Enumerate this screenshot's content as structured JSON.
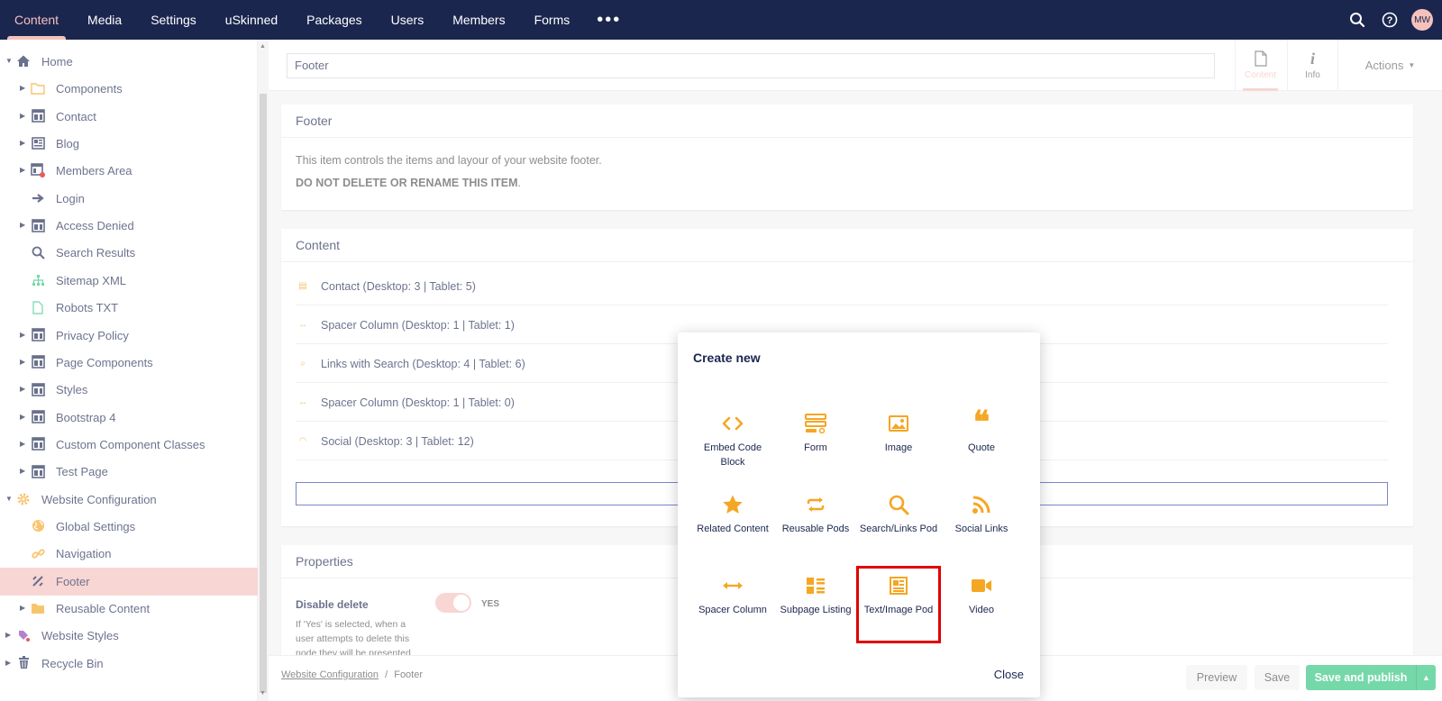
{
  "nav": {
    "items": [
      "Content",
      "Media",
      "Settings",
      "uSkinned",
      "Packages",
      "Users",
      "Members",
      "Forms"
    ],
    "more": "•••",
    "avatar": "MW"
  },
  "tree": [
    {
      "label": "Home",
      "icon": "home-icon"
    },
    {
      "label": "Components",
      "icon": "folder-icon"
    },
    {
      "label": "Contact",
      "icon": "layout-icon"
    },
    {
      "label": "Blog",
      "icon": "newspaper-icon"
    },
    {
      "label": "Members Area",
      "icon": "restricted-layout-icon"
    },
    {
      "label": "Login",
      "icon": "arrow-right-icon"
    },
    {
      "label": "Access Denied",
      "icon": "layout-icon"
    },
    {
      "label": "Search Results",
      "icon": "search-icon"
    },
    {
      "label": "Sitemap XML",
      "icon": "sitemap-icon"
    },
    {
      "label": "Robots TXT",
      "icon": "document-icon"
    },
    {
      "label": "Privacy Policy",
      "icon": "layout-icon"
    },
    {
      "label": "Page Components",
      "icon": "layout-icon"
    },
    {
      "label": "Styles",
      "icon": "layout-icon"
    },
    {
      "label": "Bootstrap 4",
      "icon": "layout-icon"
    },
    {
      "label": "Custom Component Classes",
      "icon": "layout-icon"
    },
    {
      "label": "Test Page",
      "icon": "layout-icon"
    },
    {
      "label": "Website Configuration",
      "icon": "gear-icon"
    },
    {
      "label": "Global Settings",
      "icon": "globe-icon"
    },
    {
      "label": "Navigation",
      "icon": "link-icon"
    },
    {
      "label": "Footer",
      "icon": "footer-icon"
    },
    {
      "label": "Reusable Content",
      "icon": "folder-filled-icon"
    },
    {
      "label": "Website Styles",
      "icon": "palette-icon"
    },
    {
      "label": "Recycle Bin",
      "icon": "trash-icon"
    }
  ],
  "editor": {
    "node_name": "Footer",
    "tabs": [
      {
        "label": "Content"
      },
      {
        "label": "Info"
      }
    ],
    "actions_label": "Actions",
    "footer_panel": {
      "title": "Footer",
      "description": "This item controls the items and layour of your website footer.",
      "warning": "DO NOT DELETE OR RENAME THIS ITEM",
      "warning_suffix": "."
    },
    "content_panel": {
      "title": "Content",
      "blocks": [
        "Contact (Desktop: 3 | Tablet: 5)",
        "Spacer Column (Desktop: 1 | Tablet: 1)",
        "Links with Search (Desktop: 4 | Tablet: 6)",
        "Spacer Column (Desktop: 1 | Tablet: 0)",
        "Social (Desktop: 3 | Tablet: 12)"
      ]
    },
    "properties_panel": {
      "title": "Properties",
      "disable_delete_label": "Disable delete",
      "disable_delete_desc": "If 'Yes' is selected, when a user attempts to delete this node they will be presented",
      "toggle_value": "YES"
    }
  },
  "footer_bar": {
    "breadcrumb_parent": "Website Configuration",
    "breadcrumb_sep": "/",
    "breadcrumb_current": "Footer",
    "preview": "Preview",
    "save": "Save",
    "save_publish": "Save and publish"
  },
  "modal": {
    "title": "Create new",
    "items": [
      {
        "label": "Embed Code Block",
        "icon": "code-icon"
      },
      {
        "label": "Form",
        "icon": "form-icon"
      },
      {
        "label": "Image",
        "icon": "image-icon"
      },
      {
        "label": "Quote",
        "icon": "quote-icon"
      },
      {
        "label": "Related Content",
        "icon": "star-icon"
      },
      {
        "label": "Reusable Pods",
        "icon": "repeat-icon"
      },
      {
        "label": "Search/Links Pod",
        "icon": "search-icon"
      },
      {
        "label": "Social Links",
        "icon": "rss-icon"
      },
      {
        "label": "Spacer Column",
        "icon": "arrows-horizontal-icon"
      },
      {
        "label": "Subpage Listing",
        "icon": "list-icon"
      },
      {
        "label": "Text/Image Pod",
        "icon": "text-image-icon"
      },
      {
        "label": "Video",
        "icon": "video-camera-icon"
      }
    ],
    "close_label": "Close"
  },
  "colors": {
    "nav_bg": "#1b264f",
    "accent": "#f5c1bc",
    "orange": "#f5a623",
    "green": "#2bc37c",
    "highlight": "#e00000"
  }
}
